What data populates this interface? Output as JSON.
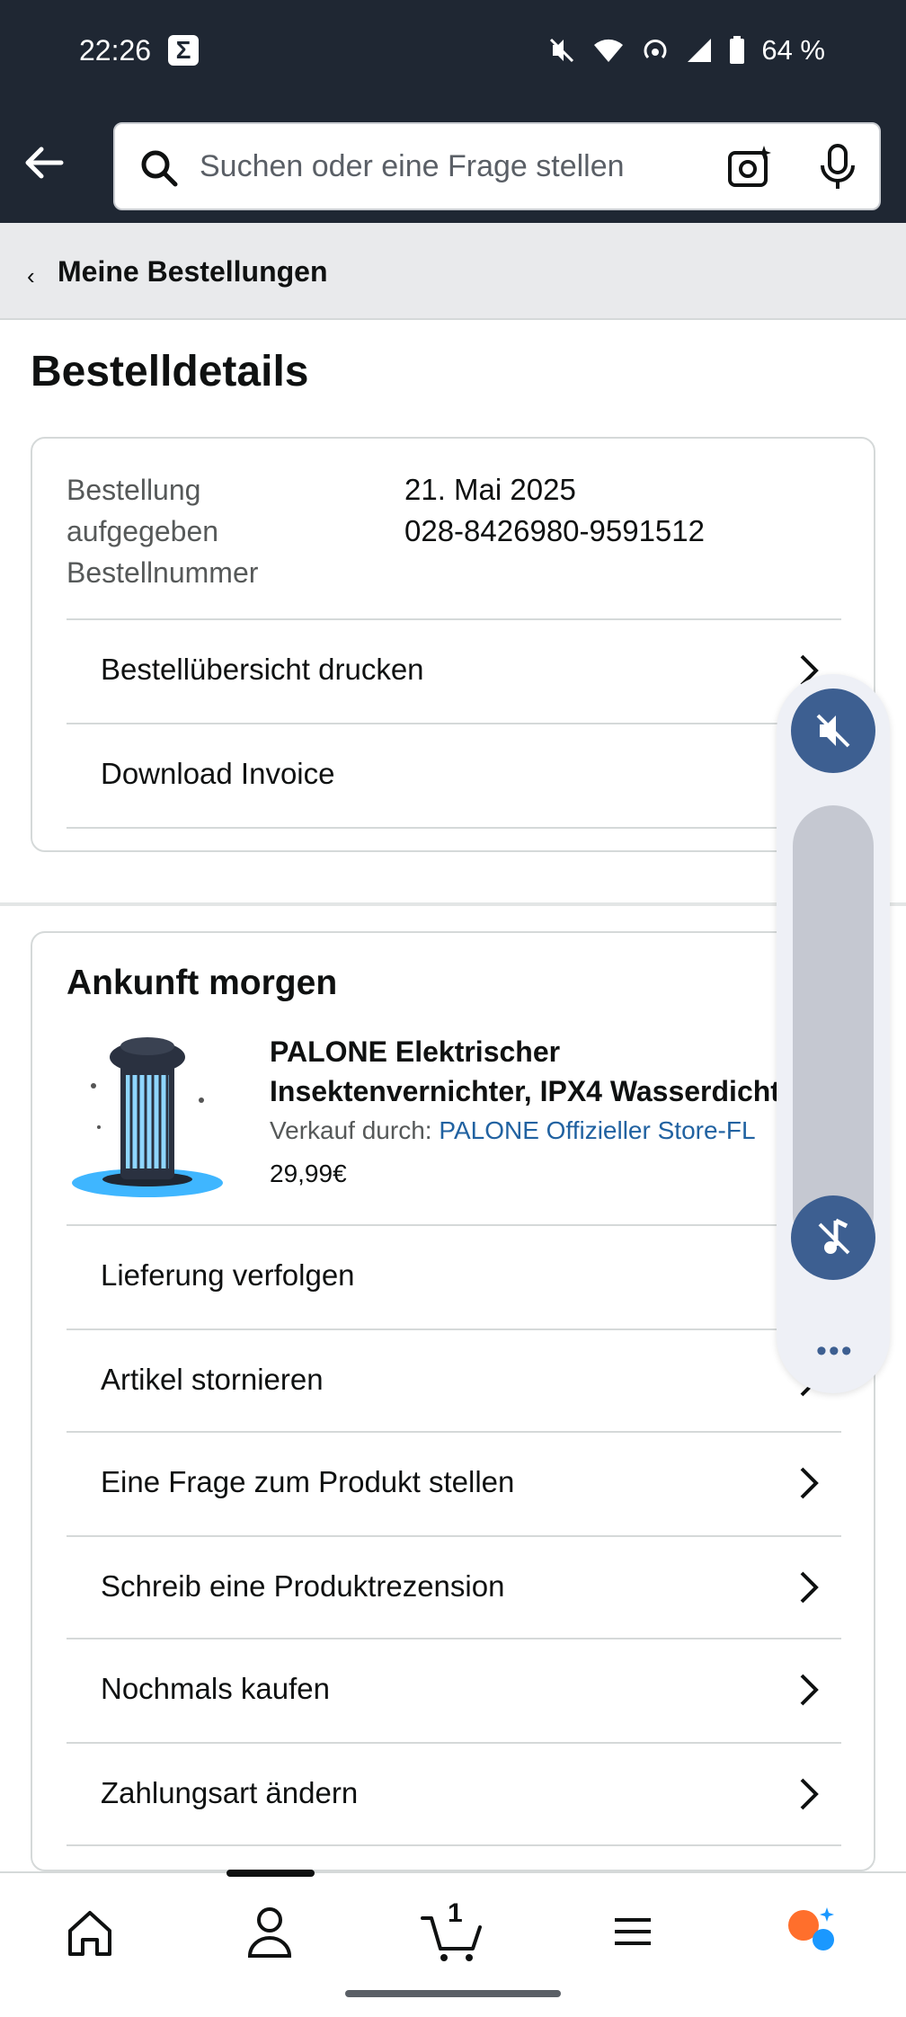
{
  "status_bar": {
    "time": "22:26",
    "battery": "64 %"
  },
  "search": {
    "placeholder": "Suchen oder eine Frage stellen"
  },
  "breadcrumb": {
    "label": "Meine Bestellungen"
  },
  "page": {
    "title": "Bestelldetails"
  },
  "order": {
    "placed_label_line1": "Bestellung",
    "placed_label_line2": "aufgegeben",
    "number_label": "Bestellnummer",
    "date": "21. Mai 2025",
    "number": "028-8426980-9591512",
    "actions": [
      "Bestellübersicht drucken",
      "Download Invoice"
    ]
  },
  "shipment": {
    "title": "Ankunft morgen",
    "product_name_line1": "PALONE Elektrischer",
    "product_name_line2": "Insektenvernichter, IPX4 Wasserdicht",
    "seller_prefix": "Verkauf durch: ",
    "seller_name": "PALONE Offizieller Store-FL",
    "price": "29,99€",
    "actions": [
      "Lieferung verfolgen",
      "Artikel stornieren",
      "Eine Frage zum Produkt stellen",
      "Schreib eine Produktrezension",
      "Nochmals kaufen",
      "Zahlungsart ändern"
    ]
  },
  "bottom_nav": {
    "cart_count": "1",
    "items": [
      "home-icon",
      "account-icon",
      "cart-icon",
      "menu-icon",
      "rufus-assistant-icon"
    ],
    "active_index": 1
  },
  "colors": {
    "header_bg": "#1f2733",
    "link": "#2162a1",
    "overlay_accent": "#3d5f91",
    "assistant_orange": "#ff6f2c",
    "assistant_blue": "#1a98ff"
  }
}
